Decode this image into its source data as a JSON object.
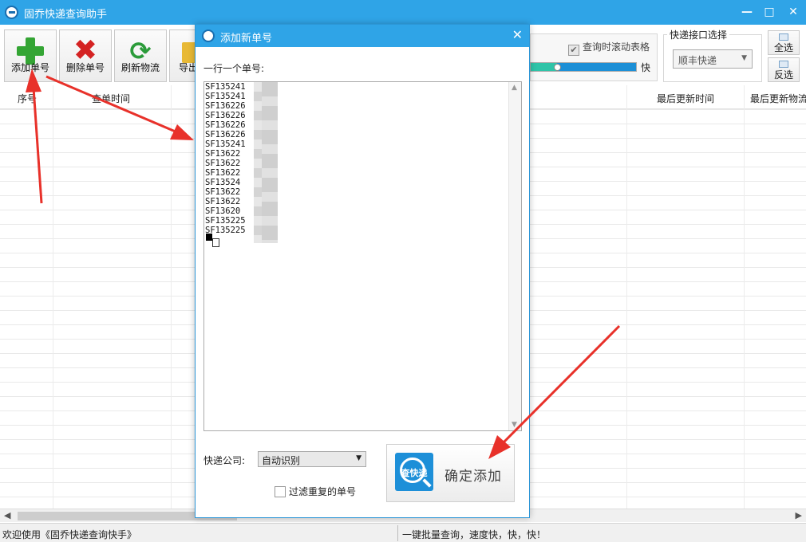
{
  "window": {
    "title": "固乔快递查询助手",
    "minimize": "—",
    "maximize": "□",
    "close": "✕"
  },
  "toolbar": {
    "add": "添加单号",
    "delete": "删除单号",
    "refresh": "刷新物流",
    "export": "导出"
  },
  "options": {
    "scroll_check": "查询时滚动表格",
    "speed_label": "快",
    "speed_level_percent": 25,
    "api_group_title": "快递接口选择",
    "api_selected": "顺丰快递",
    "select_all": "全选",
    "invert": "反选"
  },
  "table": {
    "headers": [
      "序号",
      "查单时间",
      "最后更新时间",
      "最后更新物流"
    ]
  },
  "status": {
    "left": "欢迎使用《固乔快递查询快手》",
    "right": "一键批量查询，速度快，快，快！"
  },
  "dialog": {
    "title": "添加新单号",
    "close": "✕",
    "prompt": "一行一个单号:",
    "numbers": [
      "SF135241",
      "SF135241",
      "SF136226",
      "SF136226",
      "SF136226",
      "SF136226",
      "SF135241",
      "SF13622",
      "SF13622",
      "SF13622",
      "SF13524",
      "SF13622",
      "SF13622",
      "SF13620",
      "SF135225",
      "SF135225"
    ],
    "courier_label": "快递公司:",
    "courier_selected": "自动识别",
    "filter_label": "过滤重复的单号",
    "logo_text": "查快递",
    "confirm": "确定添加"
  },
  "colors": {
    "titlebar": "#2fa4e7",
    "arrow": "#e8312a"
  }
}
